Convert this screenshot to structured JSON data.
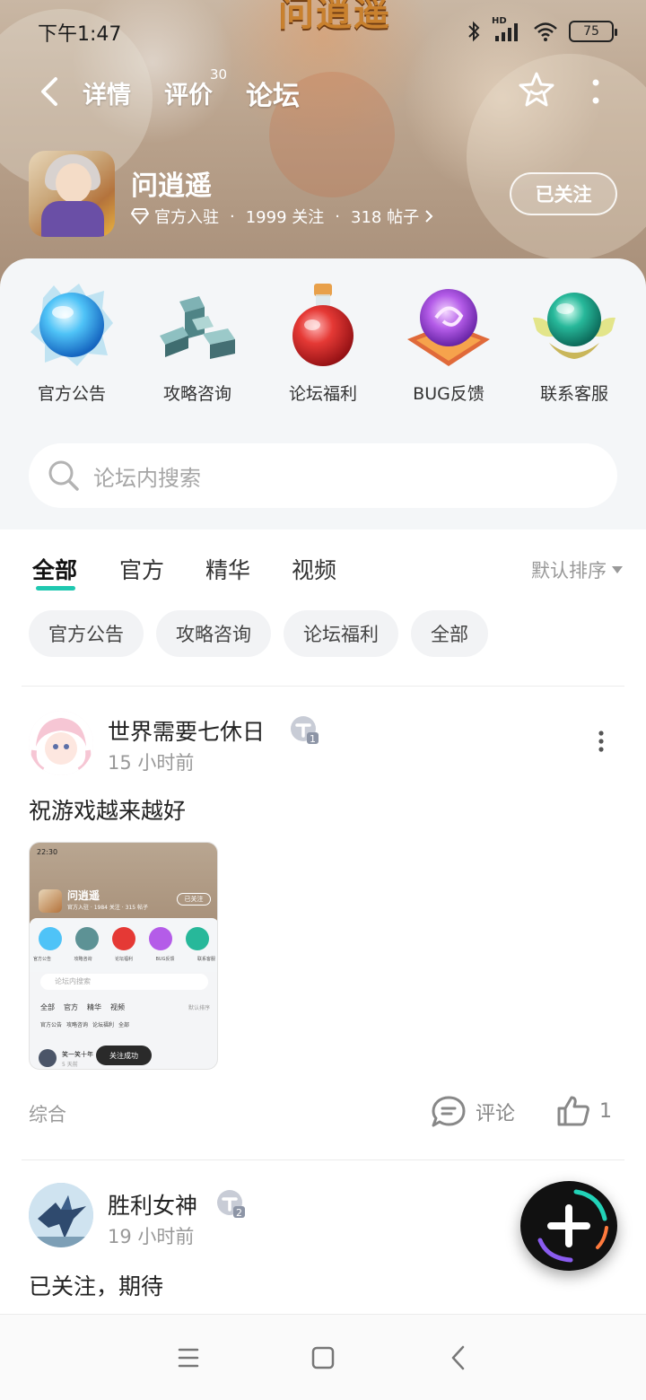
{
  "status_bar": {
    "time": "下午1:47",
    "network": "HD",
    "battery": "75"
  },
  "banner": {
    "game_mark": "问逍遥"
  },
  "nav": {
    "tabs": [
      {
        "label": "详情",
        "active": false
      },
      {
        "label": "评价",
        "active": false,
        "badge": "30"
      },
      {
        "label": "论坛",
        "active": true
      }
    ]
  },
  "game": {
    "title": "问逍遥",
    "official": "官方入驻",
    "dot1": "·",
    "follows": "1999 关注",
    "dot2": "·",
    "posts": "318 帖子",
    "follow_button": "已关注"
  },
  "categories": [
    {
      "label": "官方公告",
      "icon": "blue-crystal-orb-icon"
    },
    {
      "label": "攻略咨询",
      "icon": "stone-blocks-icon"
    },
    {
      "label": "论坛福利",
      "icon": "red-potion-icon"
    },
    {
      "label": "BUG反馈",
      "icon": "purple-orb-icon"
    },
    {
      "label": "联系客服",
      "icon": "green-orb-lotus-icon"
    }
  ],
  "search": {
    "placeholder": "论坛内搜索"
  },
  "filter_tabs": [
    {
      "label": "全部",
      "active": true
    },
    {
      "label": "官方",
      "active": false
    },
    {
      "label": "精华",
      "active": false
    },
    {
      "label": "视频",
      "active": false
    }
  ],
  "sort_label": "默认排序",
  "chips": [
    "官方公告",
    "攻略咨询",
    "论坛福利",
    "全部"
  ],
  "posts": [
    {
      "author": "世界需要七休日",
      "level": "1",
      "time": "15 小时前",
      "text": "祝游戏越来越好",
      "tag": "综合",
      "comment_label": "评论",
      "likes": "1",
      "thumbnail": {
        "time": "22:30",
        "title": "问逍遥",
        "follow": "已关注",
        "meta": "官方入驻 · 1984 关注 · 315 帖子",
        "cats": [
          "官方公告",
          "攻略咨询",
          "论坛福利",
          "BUG反馈",
          "联系客服"
        ],
        "search": "论坛内搜索",
        "tabs": [
          "全部",
          "官方",
          "精华",
          "视频"
        ],
        "sort": "默认排序",
        "chips": [
          "官方公告",
          "攻略咨询",
          "论坛福利",
          "全部"
        ],
        "post_author": "笑一笑十年",
        "post_time": "5 天前",
        "toast": "关注成功"
      }
    },
    {
      "author": "胜利女神",
      "level": "2",
      "time": "19 小时前",
      "text": "已关注，期待"
    }
  ],
  "colors": {
    "accent": "#1fc8b0",
    "panel_bg": "#f4f6f8",
    "muted_text": "#999999"
  }
}
